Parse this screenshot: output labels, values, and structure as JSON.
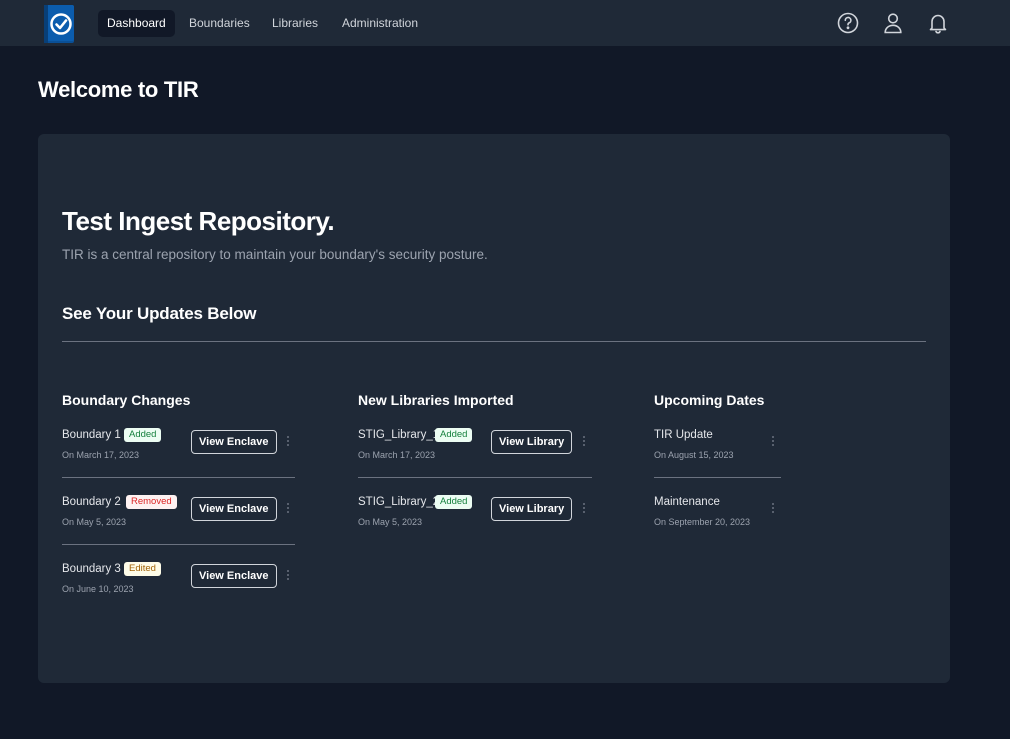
{
  "nav": {
    "items": [
      {
        "label": "Dashboard",
        "active": true
      },
      {
        "label": "Boundaries",
        "active": false
      },
      {
        "label": "Libraries",
        "active": false
      },
      {
        "label": "Administration",
        "active": false
      }
    ],
    "icons": [
      "help-circle-icon",
      "user-icon",
      "bell-icon"
    ]
  },
  "page": {
    "welcome": "Welcome to TIR",
    "hero_title": "Test Ingest Repository.",
    "hero_subtitle": "TIR is a central repository to maintain your boundary's security posture.",
    "updates_title": "See Your Updates Below"
  },
  "boundary_changes": {
    "title": "Boundary Changes",
    "button_label": "View Enclave",
    "items": [
      {
        "name": "Boundary 1",
        "badge": "Added",
        "date": "On March 17, 2023"
      },
      {
        "name": "Boundary 2",
        "badge": "Removed",
        "date": "On May 5, 2023"
      },
      {
        "name": "Boundary 3",
        "badge": "Edited",
        "date": "On June 10, 2023"
      }
    ]
  },
  "libraries": {
    "title": "New Libraries Imported",
    "button_label": "View Library",
    "items": [
      {
        "name": "STIG_Library_1",
        "badge": "Added",
        "date": "On March 17, 2023"
      },
      {
        "name": "STIG_Library_2",
        "badge": "Added",
        "date": "On May 5, 2023"
      }
    ]
  },
  "upcoming": {
    "title": "Upcoming Dates",
    "items": [
      {
        "name": "TIR Update",
        "date": "On August 15, 2023"
      },
      {
        "name": "Maintenance",
        "date": "On September 20, 2023"
      }
    ]
  },
  "colors": {
    "background": "#111827",
    "surface": "#1f2937",
    "logo_blue": "#0b5cad",
    "added": "#15803d",
    "removed": "#dc2626",
    "edited": "#a16207"
  }
}
